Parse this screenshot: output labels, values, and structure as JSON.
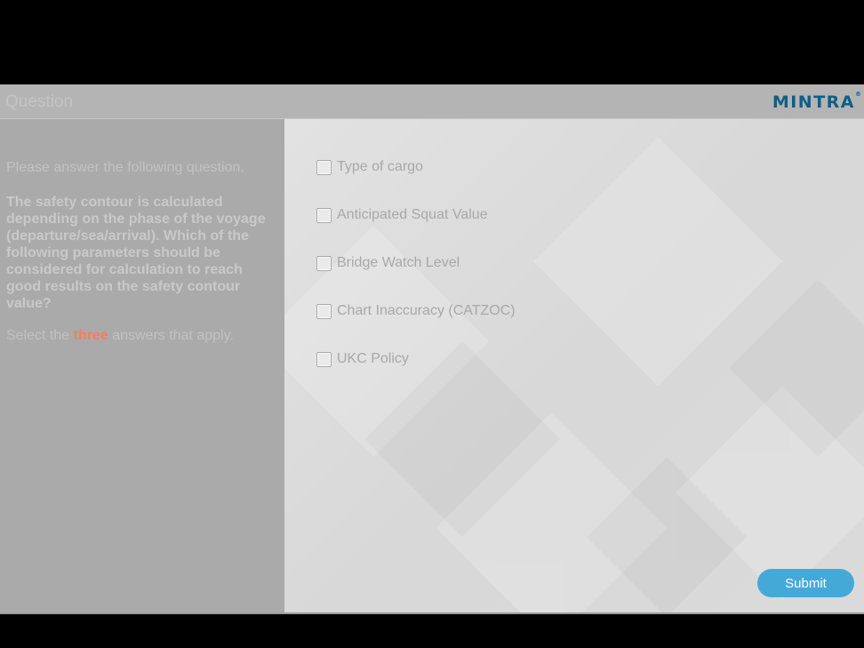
{
  "header": {
    "title": "Question",
    "logo": "MINTRA",
    "logo_mark": "®"
  },
  "left_panel": {
    "instruction": "Please answer the following question.",
    "question": "The safety contour is calculated depending on the phase of the voyage (departure/sea/arrival). Which of the following parameters should be considered for calculation to reach good results on the safety contour value?",
    "select_prefix": "Select the",
    "select_emphasis": "three",
    "select_suffix": "answers that apply."
  },
  "options": [
    {
      "label": "Type of cargo",
      "checked": false
    },
    {
      "label": "Anticipated Squat Value",
      "checked": false
    },
    {
      "label": "Bridge Watch Level",
      "checked": false
    },
    {
      "label": "Chart Inaccuracy (CATZOC)",
      "checked": false
    },
    {
      "label": "UKC Policy",
      "checked": false
    }
  ],
  "submit_label": "Submit",
  "colors": {
    "accent": "#45a9d8",
    "emphasis": "#ff7a5a",
    "logo": "#0f5f86"
  }
}
